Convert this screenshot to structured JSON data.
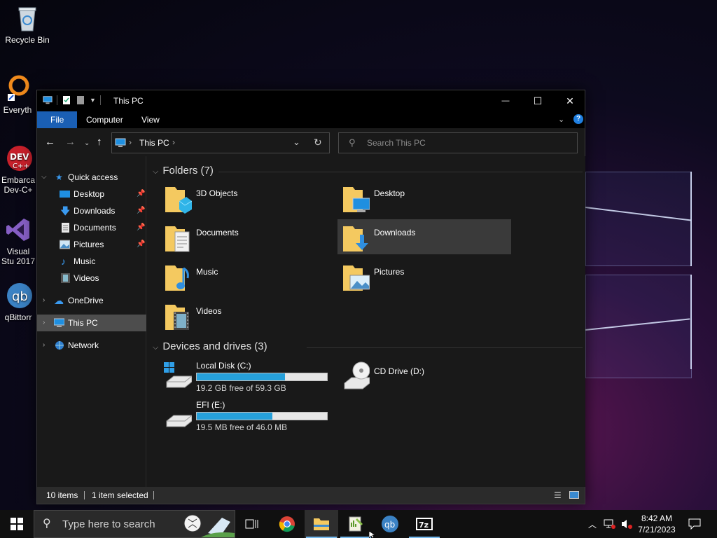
{
  "desktop": {
    "icons": [
      {
        "label": "Recycle Bin"
      },
      {
        "label": "Everyth"
      },
      {
        "label": "Embarca Dev-C+"
      },
      {
        "label": "Visual Stu 2017"
      },
      {
        "label": "qBittorr"
      }
    ]
  },
  "window": {
    "title": "This PC",
    "controls": {
      "minimize": "—",
      "maximize": "☐",
      "close": "✕"
    },
    "ribbon_tabs": {
      "file": "File",
      "computer": "Computer",
      "view": "View"
    },
    "help": "?"
  },
  "address": {
    "path": "This PC",
    "search_placeholder": "Search This PC"
  },
  "nav": {
    "quick_access": "Quick access",
    "qa_items": [
      "Desktop",
      "Downloads",
      "Documents",
      "Pictures",
      "Music",
      "Videos"
    ],
    "onedrive": "OneDrive",
    "this_pc": "This PC",
    "network": "Network"
  },
  "content": {
    "folders_header": "Folders (7)",
    "folders": [
      "3D Objects",
      "Desktop",
      "Documents",
      "Downloads",
      "Music",
      "Pictures",
      "Videos"
    ],
    "drives_header": "Devices and drives (3)",
    "drives": [
      {
        "name": "Local Disk (C:)",
        "free": "19.2 GB free of 59.3 GB",
        "used_fraction": 0.68
      },
      {
        "name": "CD Drive (D:)"
      },
      {
        "name": "EFI (E:)",
        "free": "19.5 MB free of 46.0 MB",
        "used_fraction": 0.58
      }
    ]
  },
  "status": {
    "items": "10 items",
    "selected": "1 item selected"
  },
  "taskbar": {
    "search_placeholder": "Type here to search",
    "time": "8:42 AM",
    "date": "7/21/2023"
  },
  "colors": {
    "accent": "#1a5fb4",
    "drive_bar": "#26a0da",
    "folder": "#f4c960"
  }
}
